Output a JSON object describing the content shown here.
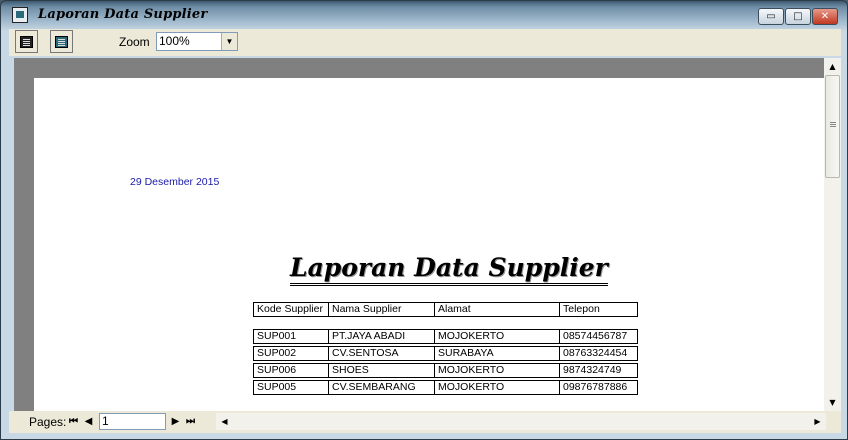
{
  "window": {
    "title": "Laporan Data Supplier",
    "minimize_glyph": "▭",
    "maximize_glyph": "□",
    "close_glyph": "✕"
  },
  "toolbar": {
    "zoom_label": "Zoom",
    "zoom_value": "100%",
    "dropdown_arrow": "▼"
  },
  "report": {
    "date": "29 Desember 2015",
    "title": "Laporan Data Supplier",
    "columns": [
      "Kode Supplier",
      "Nama Supplier",
      "Alamat",
      "Telepon"
    ],
    "rows": [
      [
        "SUP001",
        "PT.JAYA ABADI",
        "MOJOKERTO",
        "08574456787"
      ],
      [
        "SUP002",
        "CV.SENTOSA",
        "SURABAYA",
        "08763324454"
      ],
      [
        "SUP006",
        "SHOES",
        "MOJOKERTO",
        "9874324749"
      ],
      [
        "SUP005",
        "CV.SEMBARANG",
        "MOJOKERTO",
        "09876787886"
      ]
    ]
  },
  "navigation": {
    "pages_label": "Pages:",
    "current_page": "1",
    "first_glyph": "⏮",
    "prev_glyph": "◀",
    "next_glyph": "▶",
    "last_glyph": "⏭"
  },
  "scrollbars": {
    "up_glyph": "▲",
    "down_glyph": "▼",
    "left_glyph": "◀",
    "right_glyph": "▶"
  }
}
